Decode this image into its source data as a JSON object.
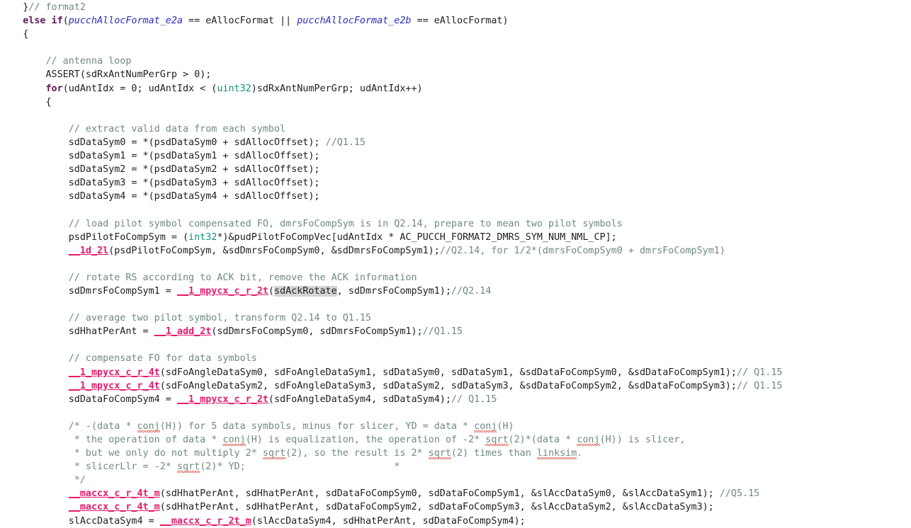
{
  "editor": {
    "app": "code-editor",
    "language": "c",
    "background": "#ffffff",
    "colors": {
      "text": "#202020",
      "comment": "#6f8a7c",
      "keyword": "#5c1a5c",
      "type": "#118f7c",
      "identifier": "#2b2bbd",
      "function": "#e31b6d",
      "highlight": "#d4d4d4",
      "spellcheck_squiggle": "#d93025"
    },
    "occurrence_highlight_token": "sdAckRotate"
  },
  "lines": [
    {
      "n": 1,
      "tokens": [
        {
          "text": "    }",
          "style": "plain"
        },
        {
          "text": "// format2",
          "style": "comment"
        }
      ]
    },
    {
      "n": 2,
      "tokens": [
        {
          "text": "    ",
          "style": "plain"
        },
        {
          "text": "else if",
          "style": "kw"
        },
        {
          "text": "(",
          "style": "plain"
        },
        {
          "text": "pucchAllocFormat_e2a",
          "style": "id"
        },
        {
          "text": " == eAllocFormat || ",
          "style": "plain"
        },
        {
          "text": "pucchAllocFormat_e2b",
          "style": "id"
        },
        {
          "text": " == eAllocFormat)",
          "style": "plain"
        }
      ]
    },
    {
      "n": 3,
      "tokens": [
        {
          "text": "    {",
          "style": "plain"
        }
      ]
    },
    {
      "n": 4,
      "tokens": []
    },
    {
      "n": 5,
      "tokens": [
        {
          "text": "        ",
          "style": "plain"
        },
        {
          "text": "// antenna loop",
          "style": "comment"
        }
      ]
    },
    {
      "n": 6,
      "tokens": [
        {
          "text": "        ASSERT(sdRxAntNumPerGrp > 0);",
          "style": "plain"
        }
      ]
    },
    {
      "n": 7,
      "tokens": [
        {
          "text": "        ",
          "style": "plain"
        },
        {
          "text": "for",
          "style": "kw"
        },
        {
          "text": "(udAntIdx = 0; udAntIdx < (",
          "style": "plain"
        },
        {
          "text": "uint32",
          "style": "type"
        },
        {
          "text": ")sdRxAntNumPerGrp; udAntIdx++)",
          "style": "plain"
        }
      ]
    },
    {
      "n": 8,
      "tokens": [
        {
          "text": "        {",
          "style": "plain"
        }
      ]
    },
    {
      "n": 9,
      "tokens": []
    },
    {
      "n": 10,
      "tokens": [
        {
          "text": "            ",
          "style": "plain"
        },
        {
          "text": "// extract valid data from each symbol",
          "style": "comment"
        }
      ]
    },
    {
      "n": 11,
      "tokens": [
        {
          "text": "            sdDataSym0 = *(psdDataSym0 + sdAllocOffset); ",
          "style": "plain"
        },
        {
          "text": "//Q1.15",
          "style": "comment"
        }
      ]
    },
    {
      "n": 12,
      "tokens": [
        {
          "text": "            sdDataSym1 = *(psdDataSym1 + sdAllocOffset);",
          "style": "plain"
        }
      ]
    },
    {
      "n": 13,
      "tokens": [
        {
          "text": "            sdDataSym2 = *(psdDataSym2 + sdAllocOffset);",
          "style": "plain"
        }
      ]
    },
    {
      "n": 14,
      "tokens": [
        {
          "text": "            sdDataSym3 = *(psdDataSym3 + sdAllocOffset);",
          "style": "plain"
        }
      ]
    },
    {
      "n": 15,
      "tokens": [
        {
          "text": "            sdDataSym4 = *(psdDataSym4 + sdAllocOffset);",
          "style": "plain"
        }
      ]
    },
    {
      "n": 16,
      "tokens": []
    },
    {
      "n": 17,
      "tokens": [
        {
          "text": "            ",
          "style": "plain"
        },
        {
          "text": "// load pilot symbol compensated FO, dmrsFoCompSym is in Q2.14, prepare to mean two pilot symbols",
          "style": "comment"
        }
      ]
    },
    {
      "n": 18,
      "tokens": [
        {
          "text": "            psdPilotFoCompSym = (",
          "style": "plain"
        },
        {
          "text": "int32",
          "style": "type"
        },
        {
          "text": "*)&pudPilotFoCompVec[udAntIdx * AC_PUCCH_FORMAT2_DMRS_SYM_NUM_NML_CP];",
          "style": "plain"
        }
      ]
    },
    {
      "n": 19,
      "tokens": [
        {
          "text": "            ",
          "style": "plain"
        },
        {
          "text": "__1d_2l",
          "style": "fn"
        },
        {
          "text": "(psdPilotFoCompSym, &sdDmrsFoCompSym0, &sdDmrsFoCompSym1);",
          "style": "plain"
        },
        {
          "text": "//Q2.14, for 1/2*(dmrsFoCompSym0 + dmrsFoCompSym1)",
          "style": "comment"
        }
      ]
    },
    {
      "n": 20,
      "tokens": []
    },
    {
      "n": 21,
      "tokens": [
        {
          "text": "            ",
          "style": "plain"
        },
        {
          "text": "// rotate RS according to ACK bit, remove the ACK information",
          "style": "comment"
        }
      ]
    },
    {
      "n": 22,
      "tokens": [
        {
          "text": "            sdDmrsFoCompSym1 = ",
          "style": "plain"
        },
        {
          "text": "__1_mpycx_c_r_2t",
          "style": "fn"
        },
        {
          "text": "(",
          "style": "plain"
        },
        {
          "text": "sdAckRotate",
          "style": "hl"
        },
        {
          "text": ", sdDmrsFoCompSym1);",
          "style": "plain"
        },
        {
          "text": "//Q2.14",
          "style": "comment"
        }
      ]
    },
    {
      "n": 23,
      "tokens": []
    },
    {
      "n": 24,
      "tokens": [
        {
          "text": "            ",
          "style": "plain"
        },
        {
          "text": "// average two pilot symbol, transform Q2.14 to Q1.15",
          "style": "comment"
        }
      ]
    },
    {
      "n": 25,
      "tokens": [
        {
          "text": "            sdHhatPerAnt = ",
          "style": "plain"
        },
        {
          "text": "__1_add_2t",
          "style": "fn"
        },
        {
          "text": "(sdDmrsFoCompSym0, sdDmrsFoCompSym1);",
          "style": "plain"
        },
        {
          "text": "//Q1.15",
          "style": "comment"
        }
      ]
    },
    {
      "n": 26,
      "tokens": []
    },
    {
      "n": 27,
      "tokens": [
        {
          "text": "            ",
          "style": "plain"
        },
        {
          "text": "// compensate FO for data symbols",
          "style": "comment"
        }
      ]
    },
    {
      "n": 28,
      "tokens": [
        {
          "text": "            ",
          "style": "plain"
        },
        {
          "text": "__1_mpycx_c_r_4t",
          "style": "fn"
        },
        {
          "text": "(sdFoAngleDataSym0, sdFoAngleDataSym1, sdDataSym0, sdDataSym1, &sdDataFoCompSym0, &sdDataFoCompSym1);",
          "style": "plain"
        },
        {
          "text": "// Q1.15",
          "style": "comment"
        }
      ]
    },
    {
      "n": 29,
      "tokens": [
        {
          "text": "            ",
          "style": "plain"
        },
        {
          "text": "__1_mpycx_c_r_4t",
          "style": "fn"
        },
        {
          "text": "(sdFoAngleDataSym2, sdFoAngleDataSym3, sdDataSym2, sdDataSym3, &sdDataFoCompSym2, &sdDataFoCompSym3);",
          "style": "plain"
        },
        {
          "text": "// Q1.15",
          "style": "comment"
        }
      ]
    },
    {
      "n": 30,
      "tokens": [
        {
          "text": "            sdDataFoCompSym4 = ",
          "style": "plain"
        },
        {
          "text": "__1_mpycx_c_r_2t",
          "style": "fn"
        },
        {
          "text": "(sdFoAngleDataSym4, sdDataSym4);",
          "style": "plain"
        },
        {
          "text": "// Q1.15",
          "style": "comment"
        }
      ]
    },
    {
      "n": 31,
      "tokens": []
    },
    {
      "n": 32,
      "tokens": [
        {
          "text": "            ",
          "style": "plain"
        },
        {
          "text": "/* -(data * ",
          "style": "comment"
        },
        {
          "text": "conj",
          "style": "comment-sp"
        },
        {
          "text": "(H)) for 5 data symbols, minus for slicer, YD = data * ",
          "style": "comment"
        },
        {
          "text": "conj",
          "style": "comment-sp"
        },
        {
          "text": "(H)",
          "style": "comment"
        }
      ]
    },
    {
      "n": 33,
      "tokens": [
        {
          "text": "             ",
          "style": "plain"
        },
        {
          "text": "* the operation of data * ",
          "style": "comment"
        },
        {
          "text": "conj",
          "style": "comment-sp"
        },
        {
          "text": "(H) is equalization, the operation of -2* ",
          "style": "comment"
        },
        {
          "text": "sqrt",
          "style": "comment-sp"
        },
        {
          "text": "(2)*(data * ",
          "style": "comment"
        },
        {
          "text": "conj",
          "style": "comment-sp"
        },
        {
          "text": "(H)) is slicer,",
          "style": "comment"
        }
      ]
    },
    {
      "n": 34,
      "tokens": [
        {
          "text": "             ",
          "style": "plain"
        },
        {
          "text": "* but we only do not multiply 2* ",
          "style": "comment"
        },
        {
          "text": "sqrt",
          "style": "comment-sp"
        },
        {
          "text": "(2), so the result is 2* ",
          "style": "comment"
        },
        {
          "text": "sqrt",
          "style": "comment-sp"
        },
        {
          "text": "(2) times than ",
          "style": "comment"
        },
        {
          "text": "linksim",
          "style": "comment-sp"
        },
        {
          "text": ".",
          "style": "comment"
        }
      ]
    },
    {
      "n": 35,
      "tokens": [
        {
          "text": "             ",
          "style": "plain"
        },
        {
          "text": "* slicerLlr = -2* ",
          "style": "comment"
        },
        {
          "text": "sqrt",
          "style": "comment-sp"
        },
        {
          "text": "(2)* YD;                          *",
          "style": "comment"
        }
      ]
    },
    {
      "n": 36,
      "tokens": [
        {
          "text": "             ",
          "style": "plain"
        },
        {
          "text": "*/",
          "style": "comment"
        }
      ]
    },
    {
      "n": 37,
      "tokens": [
        {
          "text": "            ",
          "style": "plain"
        },
        {
          "text": "__maccx_c_r_4t_m",
          "style": "fn"
        },
        {
          "text": "(sdHhatPerAnt, sdHhatPerAnt, sdDataFoCompSym0, sdDataFoCompSym1, &slAccDataSym0, &slAccDataSym1); ",
          "style": "plain"
        },
        {
          "text": "//Q5.15",
          "style": "comment"
        }
      ]
    },
    {
      "n": 38,
      "tokens": [
        {
          "text": "            ",
          "style": "plain"
        },
        {
          "text": "__maccx_c_r_4t_m",
          "style": "fn"
        },
        {
          "text": "(sdHhatPerAnt, sdHhatPerAnt, sdDataFoCompSym2, sdDataFoCompSym3, &slAccDataSym2, &slAccDataSym3);",
          "style": "plain"
        }
      ]
    },
    {
      "n": 39,
      "tokens": [
        {
          "text": "            slAccDataSym4 = ",
          "style": "plain"
        },
        {
          "text": "__maccx_c_r_2t_m",
          "style": "fn"
        },
        {
          "text": "(slAccDataSym4, sdHhatPerAnt, sdDataFoCompSym4);",
          "style": "plain"
        }
      ]
    }
  ]
}
